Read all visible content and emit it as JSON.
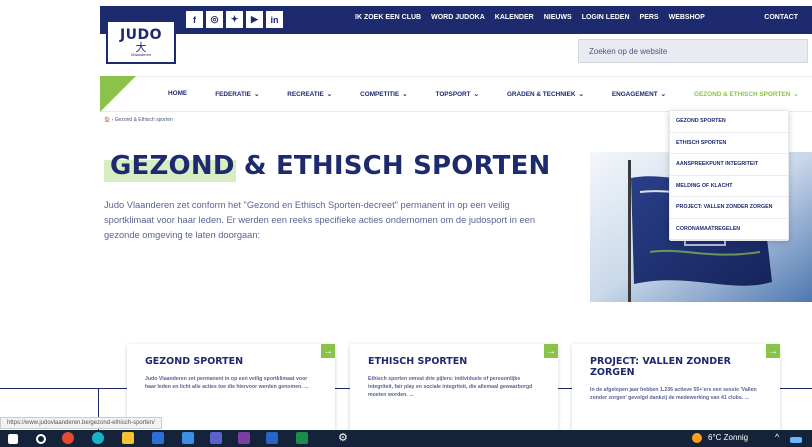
{
  "header": {
    "logo_word": "JUDO",
    "logo_sub": "Vlaanderen",
    "social_icons": [
      "facebook-icon",
      "instagram-icon",
      "twitter-icon",
      "youtube-icon",
      "linkedin-icon"
    ],
    "social_glyphs": [
      "f",
      "◎",
      "✦",
      "▶",
      "in"
    ],
    "top_links": [
      "IK ZOEK EEN CLUB",
      "WORD JUDOKA",
      "KALENDER",
      "NIEUWS",
      "LOGIN LEDEN",
      "PERS",
      "WEBSHOP"
    ],
    "contact": "CONTACT",
    "search_placeholder": "Zoeken op de website"
  },
  "nav": {
    "items": [
      {
        "label": "HOME",
        "has_menu": false
      },
      {
        "label": "FEDERATIE",
        "has_menu": true
      },
      {
        "label": "RECREATIE",
        "has_menu": true
      },
      {
        "label": "COMPETITIE",
        "has_menu": true
      },
      {
        "label": "TOPSPORT",
        "has_menu": true
      },
      {
        "label": "GRADEN & TECHNIEK",
        "has_menu": true
      },
      {
        "label": "ENGAGEMENT",
        "has_menu": true
      },
      {
        "label": "GEZOND & ETHISCH SPORTEN",
        "has_menu": true
      }
    ],
    "chevron": "⌄"
  },
  "dropdown": {
    "items": [
      "GEZOND SPORTEN",
      "ETHISCH SPORTEN",
      "AANSPREEKPUNT INTEGRITEIT",
      "MELDING OF KLACHT",
      "PROJECT: VALLEN ZONDER ZORGEN",
      "CORONAMAATREGELEN"
    ]
  },
  "breadcrumb": "🏠 › Gezond & Ethisch sporten",
  "page": {
    "title": "GEZOND & ETHISCH SPORTEN",
    "intro": "Judo Vlaanderen zet conform het \"Gezond en Ethisch Sporten-decreet\" permanent in op een veilig sportklimaat voor haar leden. Er werden een reeks specifieke acties ondernomen om de judosport in een gezonde omgeving te laten doorgaan:"
  },
  "cards": [
    {
      "title": "GEZOND SPORTEN",
      "text": "Judo Vlaanderen zet permanent in op een veilig sportklimaat voor haar leden en licht alle acties toe die hiervoor werden genomen. ..."
    },
    {
      "title": "ETHISCH SPORTEN",
      "text": "Ethisch sporten omvat drie pijlers: individuele of persoonlijke integriteit, fair play en sociale integriteit, die allemaal gewaarborgd moeten worden. ..."
    },
    {
      "title": "PROJECT: VALLEN ZONDER ZORGEN",
      "text": "In de afgelopen jaar hebben 1.236 actieve 55+'ers een sessie 'Vallen zonder zorgen' gevolgd dankzij de medewerking van 41 clubs. ..."
    }
  ],
  "card_arrow": "→",
  "status_url": "https://www.judovlaanderen.be/gezond-ethisch-sporten/",
  "taskbar": {
    "weather": "6°C Zonnig",
    "icons": [
      "windows-icon",
      "search-icon",
      "chrome-icon",
      "edge-icon",
      "file-explorer-icon",
      "store-icon",
      "mail-icon",
      "teams-icon",
      "onenote-icon",
      "word-icon",
      "excel-icon",
      "settings-icon"
    ]
  },
  "colors": {
    "navy": "#1e2a6e",
    "green": "#8bc34a"
  }
}
